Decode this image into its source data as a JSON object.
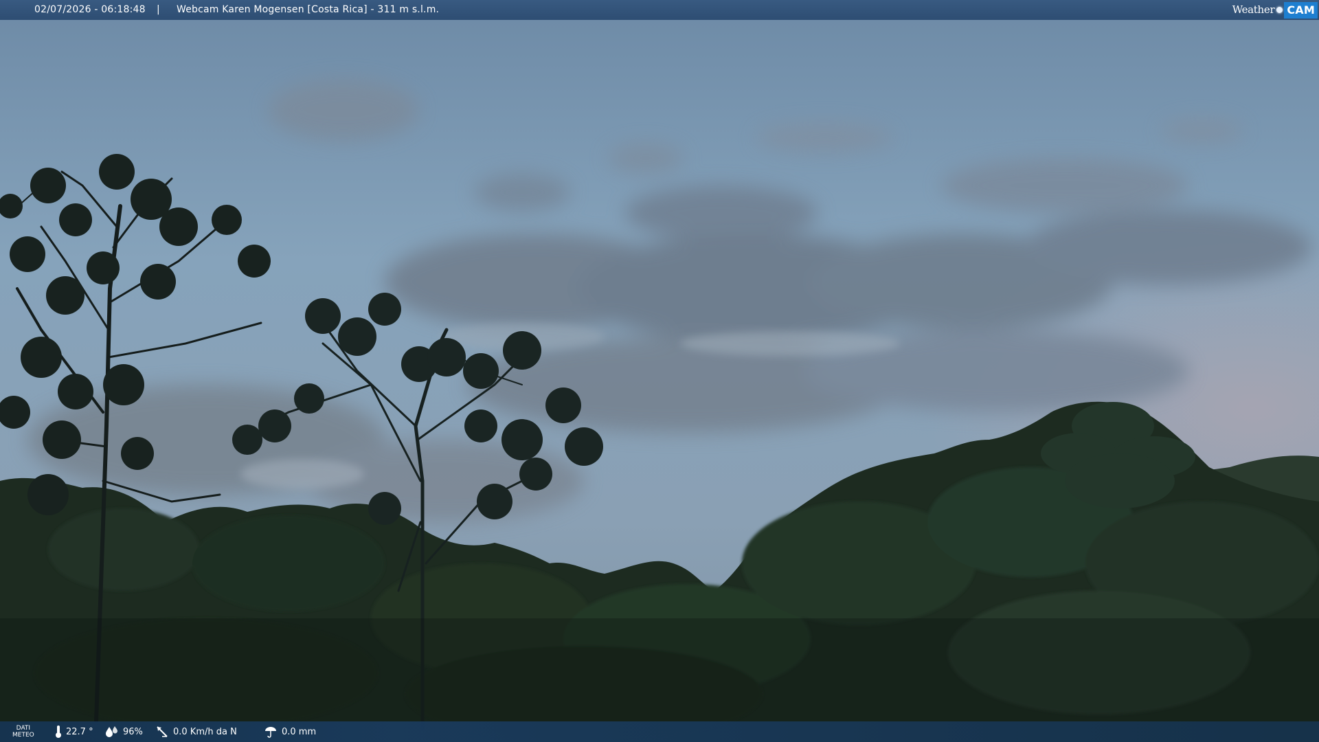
{
  "overlay": {
    "datetime": "02/07/2026 - 06:18:48",
    "separator": "|",
    "title": "Webcam Karen Mogensen [Costa Rica]  - 311 m s.l.m."
  },
  "logo": {
    "weather": "Weather",
    "cam": "CAM"
  },
  "weather_data": {
    "label_line1": "DATI",
    "label_line2": "METEO",
    "temperature": "22.7 °",
    "humidity": "96%",
    "wind": "0.0 Km/h da N",
    "rain": "0.0 mm"
  },
  "icons": {
    "temperature": "thermometer-icon",
    "humidity": "humidity-drops-icon",
    "wind": "wind-vane-icon",
    "rain": "rain-gauge-icon"
  },
  "colors": {
    "sky_top": "#6f8ca6",
    "sky_mid": "#86a2b8",
    "clouds": "#6b7a8c",
    "forest": "#1c2a20",
    "bar_blue": "#2e5580",
    "logo_blue": "#1e7fd0"
  }
}
